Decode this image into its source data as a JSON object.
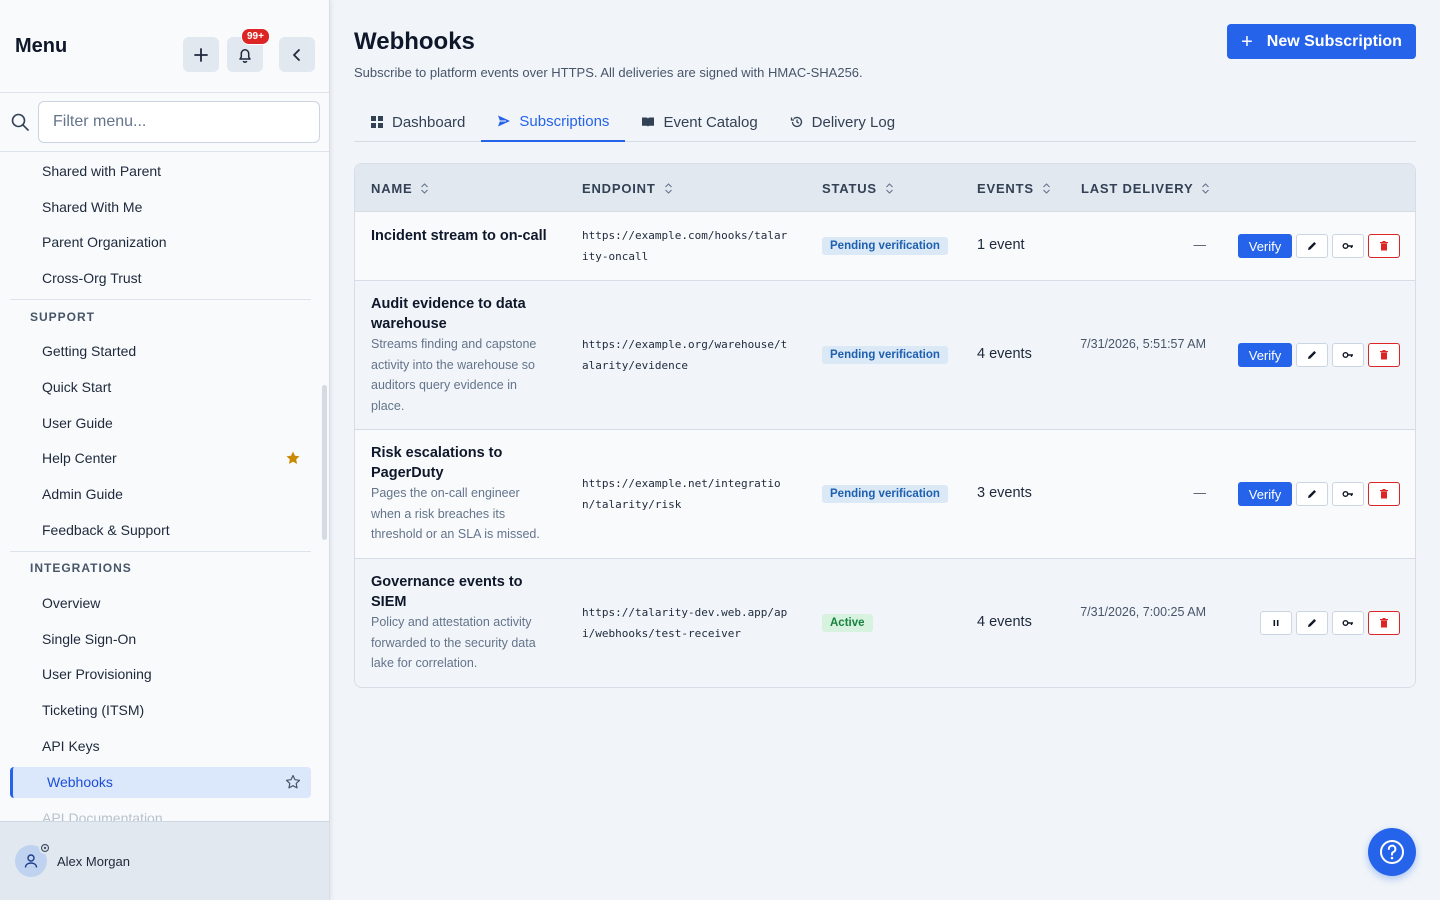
{
  "sidebar": {
    "title": "Menu",
    "notification_count": "99+",
    "filter_placeholder": "Filter menu...",
    "items_top": [
      "Shared with Parent",
      "Shared With Me",
      "Parent Organization",
      "Cross-Org Trust"
    ],
    "support_label": "SUPPORT",
    "support_items": [
      "Getting Started",
      "Quick Start",
      "User Guide",
      "Help Center",
      "Admin Guide",
      "Feedback & Support"
    ],
    "integrations_label": "INTEGRATIONS",
    "integration_items": [
      "Overview",
      "Single Sign-On",
      "User Provisioning",
      "Ticketing (ITSM)",
      "API Keys",
      "Webhooks",
      "API Documentation"
    ],
    "active_item": "Webhooks",
    "user_name": "Alex Morgan"
  },
  "header": {
    "title": "Webhooks",
    "subtitle": "Subscribe to platform events over HTTPS. All deliveries are signed with HMAC-SHA256.",
    "new_button": "New Subscription"
  },
  "tabs": [
    {
      "label": "Dashboard",
      "icon": "grid-icon"
    },
    {
      "label": "Subscriptions",
      "icon": "send-icon"
    },
    {
      "label": "Event Catalog",
      "icon": "book-icon"
    },
    {
      "label": "Delivery Log",
      "icon": "history-icon"
    }
  ],
  "active_tab": "Subscriptions",
  "table": {
    "columns": [
      "NAME",
      "ENDPOINT",
      "STATUS",
      "EVENTS",
      "LAST DELIVERY"
    ],
    "rows": [
      {
        "name": "Incident stream to on-call",
        "description": "",
        "endpoint": "https://example.com/hooks/talarity-oncall",
        "status": "Pending verification",
        "events": "1 event",
        "last_delivery": "—",
        "primary_action": "Verify"
      },
      {
        "name": "Audit evidence to data warehouse",
        "description": "Streams finding and capstone activity into the warehouse so auditors query evidence in place.",
        "endpoint": "https://example.org/warehouse/talarity/evidence",
        "status": "Pending verification",
        "events": "4 events",
        "last_delivery": "7/31/2026, 5:51:57 AM",
        "primary_action": "Verify"
      },
      {
        "name": "Risk escalations to PagerDuty",
        "description": "Pages the on-call engineer when a risk breaches its threshold or an SLA is missed.",
        "endpoint": "https://example.net/integration/talarity/risk",
        "status": "Pending verification",
        "events": "3 events",
        "last_delivery": "—",
        "primary_action": "Verify"
      },
      {
        "name": "Governance events to SIEM",
        "description": "Policy and attestation activity forwarded to the security data lake for correlation.",
        "endpoint": "https://talarity-dev.web.app/api/webhooks/test-receiver",
        "status": "Active",
        "events": "4 events",
        "last_delivery": "7/31/2026, 7:00:25 AM",
        "primary_action": "pause"
      }
    ]
  },
  "colors": {
    "accent": "#2563eb",
    "danger": "#dc2626",
    "success": "#16843f"
  }
}
